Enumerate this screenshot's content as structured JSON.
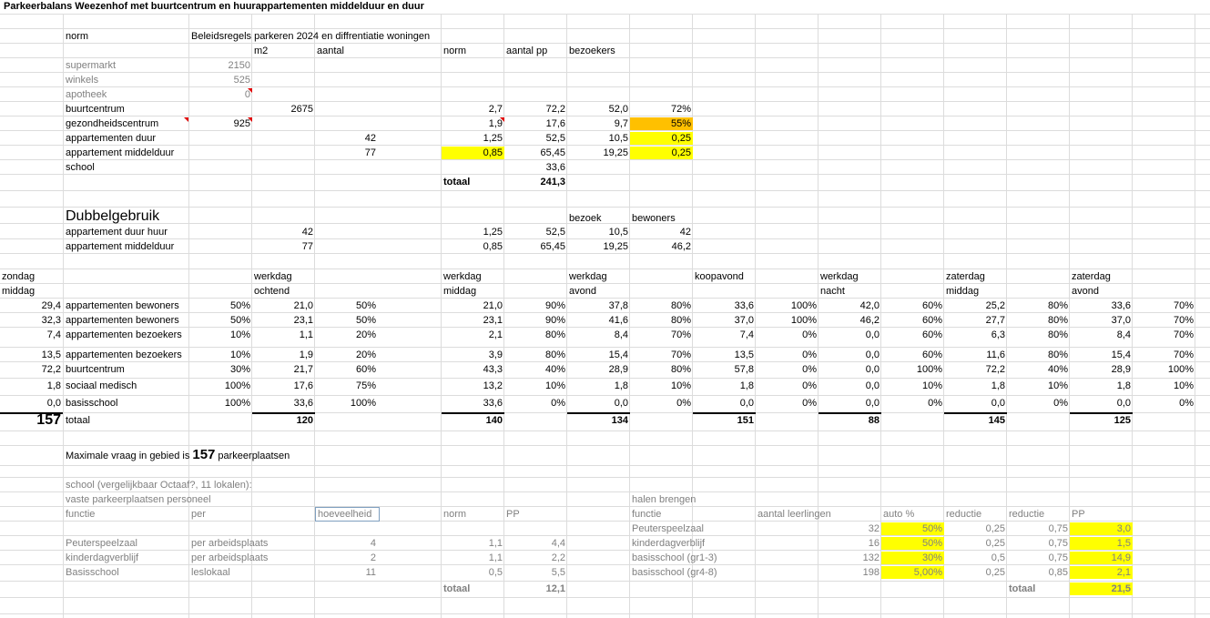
{
  "title": "Parkeerbalans Weezenhof met buurtcentrum en huurappartementen middelduur en duur",
  "norm_section": {
    "header": {
      "norm": "norm",
      "policy": "Beleidsregels parkeren 2024 en diffrentiatie woningen",
      "m2": "m2",
      "aantal": "aantal",
      "norm_col": "norm",
      "aantal_pp": "aantal pp",
      "bezoekers": "bezoekers"
    },
    "rows": [
      {
        "label": "supermarkt",
        "m2a": "2150",
        "m2b": "",
        "aantal": "",
        "norm": "",
        "pp": "",
        "bez": "",
        "pct": "",
        "gray": true
      },
      {
        "label": "winkels",
        "m2a": "525",
        "m2b": "",
        "aantal": "",
        "norm": "",
        "pp": "",
        "bez": "",
        "pct": "",
        "gray": true
      },
      {
        "label": "apotheek",
        "m2a": "0",
        "m2b": "",
        "aantal": "",
        "norm": "",
        "pp": "",
        "bez": "",
        "pct": "",
        "gray": true
      },
      {
        "label": "buurtcentrum",
        "m2a": "",
        "m2b": "2675",
        "aantal": "",
        "norm": "2,7",
        "pp": "72,2",
        "bez": "52,0",
        "pct": "72%"
      },
      {
        "label": "gezondheidscentrum",
        "m2a": "925",
        "m2b": "",
        "aantal": "",
        "norm": "1,9",
        "pp": "17,6",
        "bez": "9,7",
        "pct": "55%"
      },
      {
        "label": "appartementen duur",
        "m2a": "",
        "m2b": "",
        "aantal": "42",
        "norm": "1,25",
        "pp": "52,5",
        "bez": "10,5",
        "pct": "0,25"
      },
      {
        "label": "appartement middelduur",
        "m2a": "",
        "m2b": "",
        "aantal": "77",
        "norm": "0,85",
        "pp": "65,45",
        "bez": "19,25",
        "pct": "0,25"
      },
      {
        "label": "school",
        "m2a": "",
        "m2b": "",
        "aantal": "",
        "norm": "",
        "pp": "33,6",
        "bez": "",
        "pct": ""
      }
    ],
    "totaal_label": "totaal",
    "totaal_value": "241,3"
  },
  "dubbel": {
    "title": "Dubbelgebruik",
    "bezoek": "bezoek",
    "bewoners": "bewoners",
    "rows": [
      {
        "label": "appartement duur huur",
        "aantal": "42",
        "norm": "1,25",
        "pp": "52,5",
        "bez": "10,5",
        "bew": "42"
      },
      {
        "label": "appartement middelduur",
        "aantal": "77",
        "norm": "0,85",
        "pp": "65,45",
        "bez": "19,25",
        "bew": "46,2"
      }
    ]
  },
  "periods": [
    {
      "line1": "werkdag",
      "line2": "ochtend"
    },
    {
      "line1": "werkdag",
      "line2": "middag"
    },
    {
      "line1": "werkdag",
      "line2": "avond"
    },
    {
      "line1": "koopavond",
      "line2": ""
    },
    {
      "line1": "werkdag",
      "line2": "nacht"
    },
    {
      "line1": "zaterdag",
      "line2": "middag"
    },
    {
      "line1": "zaterdag",
      "line2": "avond"
    },
    {
      "line1": "zondag",
      "line2": "middag"
    }
  ],
  "usage_rows": [
    {
      "label": "appartementen bewoners",
      "vals": [
        "50%",
        "21,0",
        "50%",
        "21,0",
        "90%",
        "37,8",
        "80%",
        "33,6",
        "100%",
        "42,0",
        "60%",
        "25,2",
        "80%",
        "33,6",
        "70%",
        "29,4"
      ]
    },
    {
      "label": "appartementen bewoners",
      "vals": [
        "50%",
        "23,1",
        "50%",
        "23,1",
        "90%",
        "41,6",
        "80%",
        "37,0",
        "100%",
        "46,2",
        "60%",
        "27,7",
        "80%",
        "37,0",
        "70%",
        "32,3"
      ]
    },
    {
      "label": "appartementen bezoekers",
      "vals": [
        "10%",
        "1,1",
        "20%",
        "2,1",
        "80%",
        "8,4",
        "70%",
        "7,4",
        "0%",
        "0,0",
        "60%",
        "6,3",
        "80%",
        "8,4",
        "70%",
        "7,4"
      ]
    },
    {
      "label": "appartementen bezoekers",
      "vals": [
        "10%",
        "1,9",
        "20%",
        "3,9",
        "80%",
        "15,4",
        "70%",
        "13,5",
        "0%",
        "0,0",
        "60%",
        "11,6",
        "80%",
        "15,4",
        "70%",
        "13,5"
      ]
    },
    {
      "label": "buurtcentrum",
      "vals": [
        "30%",
        "21,7",
        "60%",
        "43,3",
        "40%",
        "28,9",
        "80%",
        "57,8",
        "0%",
        "0,0",
        "100%",
        "72,2",
        "40%",
        "28,9",
        "100%",
        "72,2"
      ]
    },
    {
      "label": "sociaal medisch",
      "vals": [
        "100%",
        "17,6",
        "75%",
        "13,2",
        "10%",
        "1,8",
        "10%",
        "1,8",
        "0%",
        "0,0",
        "10%",
        "1,8",
        "10%",
        "1,8",
        "10%",
        "1,8"
      ]
    },
    {
      "label": "basisschool",
      "vals": [
        "100%",
        "33,6",
        "100%",
        "33,6",
        "0%",
        "0,0",
        "0%",
        "0,0",
        "0%",
        "0,0",
        "0%",
        "0,0",
        "0%",
        "0,0",
        "0%",
        "0,0"
      ]
    }
  ],
  "totals": {
    "label": "totaal",
    "values": [
      "120",
      "140",
      "134",
      "151",
      "88",
      "145",
      "125",
      "157"
    ]
  },
  "max_text": {
    "prefix": "Maximale vraag in gebied is",
    "value": "157",
    "suffix": "parkeerplaatsen"
  },
  "school": {
    "title": "school (vergelijkbaar Octaaf?, 11 lokalen):",
    "subtitle": "vaste parkeerplaatsen personeel",
    "headers": {
      "functie": "functie",
      "per": "per",
      "hoeveelheid": "hoeveelheid",
      "norm": "norm",
      "pp": "PP"
    },
    "rows": [
      {
        "functie": "Peuterspeelzaal",
        "per": "per arbeidsplaats",
        "hoev": "4",
        "norm": "1,1",
        "pp": "4,4"
      },
      {
        "functie": "kinderdagverblijf",
        "per": "per arbeidsplaats",
        "hoev": "2",
        "norm": "1,1",
        "pp": "2,2"
      },
      {
        "functie": "Basisschool",
        "per": "leslokaal",
        "hoev": "11",
        "norm": "0,5",
        "pp": "5,5"
      }
    ],
    "totaal_label": "totaal",
    "totaal_value": "12,1"
  },
  "halen": {
    "title": "halen brengen",
    "headers": {
      "functie": "functie",
      "aantal": "aantal leerlingen",
      "auto": "auto %",
      "reductie1": "reductie",
      "reductie2": "reductie",
      "pp": "PP"
    },
    "rows": [
      {
        "functie": "Peuterspeelzaal",
        "aantal": "32",
        "auto": "50%",
        "red1": "0,25",
        "red2": "0,75",
        "pp": "3,0"
      },
      {
        "functie": "kinderdagverblijf",
        "aantal": "16",
        "auto": "50%",
        "red1": "0,25",
        "red2": "0,75",
        "pp": "1,5"
      },
      {
        "functie": "basisschool (gr1-3)",
        "aantal": "132",
        "auto": "30%",
        "red1": "0,5",
        "red2": "0,75",
        "pp": "14,9"
      },
      {
        "functie": "basisschool (gr4-8)",
        "aantal": "198",
        "auto": "5,00%",
        "red1": "0,25",
        "red2": "0,85",
        "pp": "2,1"
      }
    ],
    "totaal_label": "totaal",
    "totaal_value": "21,5"
  }
}
